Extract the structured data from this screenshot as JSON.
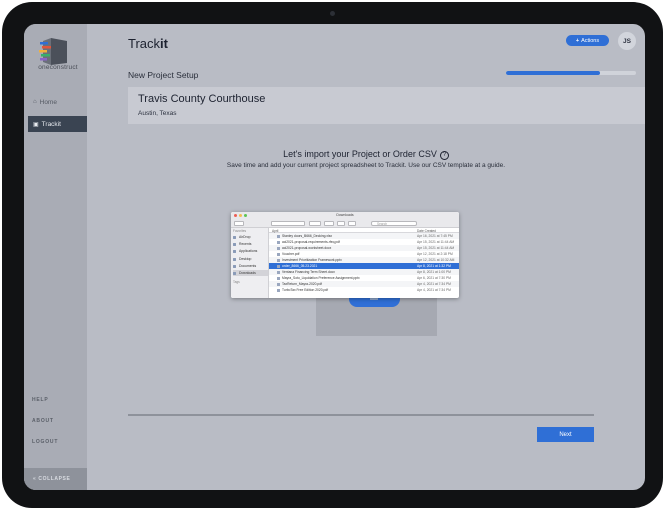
{
  "brand": {
    "name": "oneconstruct"
  },
  "sidebar": {
    "items": [
      {
        "label": "Home",
        "icon": "home-icon"
      },
      {
        "label": "Trackit",
        "icon": "trackit-icon"
      }
    ],
    "links": [
      "HELP",
      "ABOUT",
      "LOGOUT"
    ],
    "collapse_label": "COLLAPSE",
    "collapse_icon": "double-chevron-left-icon"
  },
  "header": {
    "title_regular": "Track",
    "title_bold": "it",
    "actions_label": "Actions",
    "actions_icon": "plus-icon",
    "avatar_initials": "JS"
  },
  "setup": {
    "label": "New Project Setup",
    "progress": 0.72
  },
  "project": {
    "name": "Travis County Courthouse",
    "location": "Austin, Texas"
  },
  "import": {
    "title": "Let's import your Project or Order CSV",
    "help_icon": "question-circle-icon",
    "subtitle": "Save time and add your current project spreadsheet to Trackit. Use our CSV template at a guide."
  },
  "finder": {
    "window_title": "Downloads",
    "search_placeholder": "Search",
    "favorites_label": "Favorites",
    "tags_label": "Tags",
    "sidebar_items": [
      "AirDrop",
      "Recents",
      "Applications",
      "Desktop",
      "Documents",
      "Downloads"
    ],
    "selected_sidebar": 5,
    "columns": {
      "name": "April",
      "date": "Date Created"
    },
    "files": [
      {
        "name": "Stanley doors_B666_Decking.xlsx",
        "date": "Apr 16, 2021 at 7:45 PM"
      },
      {
        "name": "aci2021-proposal-requirements-rfeq.pdf",
        "date": "Apr 15, 2021 at 11:44 AM"
      },
      {
        "name": "aci2021-proposal-worksheet.docx",
        "date": "Apr 15, 2021 at 11:44 AM"
      },
      {
        "name": "Voucher.pdf",
        "date": "Apr 12, 2021 at 2:18 PM"
      },
      {
        "name": "Investment Prioritization Framework.pptx",
        "date": "Apr 12, 2021 at 10:32 AM"
      },
      {
        "name": "order_8666_05.23.2021",
        "date": "Apr 8, 2021 at 1:32 PM",
        "selected": true
      },
      {
        "name": "Ventana Financing Term Sheet.docx",
        "date": "Apr 8, 2021 at 1:00 PM"
      },
      {
        "name": "Mayra_Soto_Liquidation Preference Assignment.pptx",
        "date": "Apr 6, 2021 at 7:30 PM"
      },
      {
        "name": "TaxReturn_Mayra-2020.pdf",
        "date": "Apr 4, 2021 at 7:34 PM"
      },
      {
        "name": "TurboTax Free Edition 2020.pdf",
        "date": "Apr 4, 2021 at 7:34 PM"
      }
    ]
  },
  "footer": {
    "next_label": "Next"
  },
  "colors": {
    "accent": "#2f6fd6",
    "sidebar_active": "#3a4452",
    "background": "#b9bcc5"
  }
}
